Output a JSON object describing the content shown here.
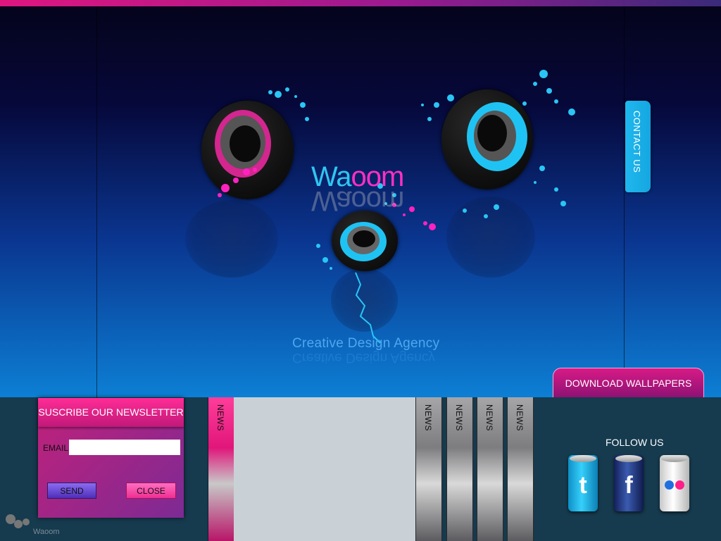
{
  "brand": {
    "logo_part1": "Wa",
    "logo_part2": "oom",
    "tagline": "Creative Design Agency",
    "footer_logo_text": "Waoom"
  },
  "colors": {
    "accent_cyan": "#2fc6f2",
    "accent_pink": "#ff2fc4",
    "hero_top": "#05041c",
    "hero_bottom": "#0c7fd4",
    "footer_bg": "#163a4e"
  },
  "hero": {
    "contact_label": "CONTACT US",
    "download_label": "DOWNLOAD WALLPAPERS"
  },
  "newsletter": {
    "title": "SUSCRIBE OUR NEWSLETTER",
    "email_label": "EMAIL",
    "email_value": "",
    "send_label": "SEND",
    "close_label": "CLOSE"
  },
  "news": {
    "tabs": [
      {
        "label": "NEWS",
        "active": true
      },
      {
        "label": "NEWS",
        "active": false
      },
      {
        "label": "NEWS",
        "active": false
      },
      {
        "label": "NEWS",
        "active": false
      },
      {
        "label": "NEWS",
        "active": false
      }
    ]
  },
  "social": {
    "title": "FOLLOW US",
    "items": [
      {
        "icon": "twitter-icon",
        "glyph": "t"
      },
      {
        "icon": "facebook-icon",
        "glyph": "f"
      },
      {
        "icon": "flickr-icon",
        "glyph": ""
      }
    ]
  }
}
